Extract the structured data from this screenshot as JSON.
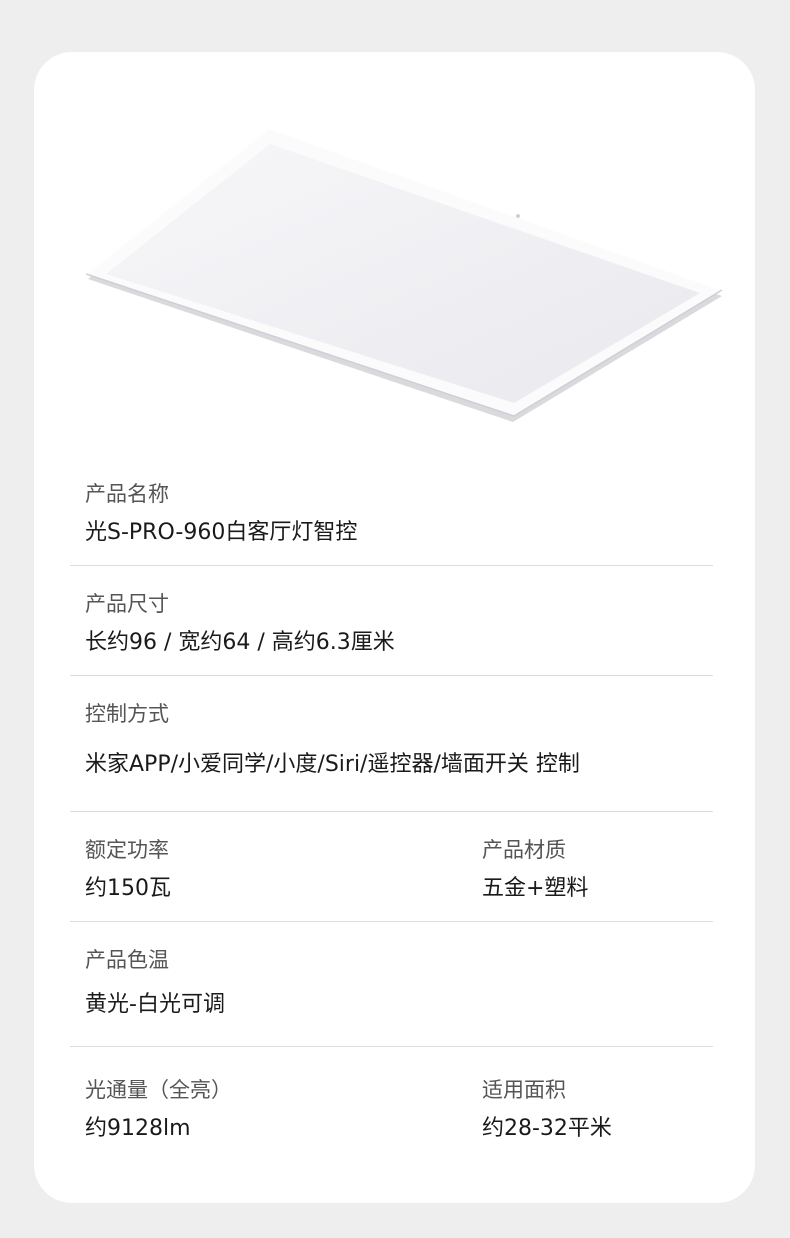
{
  "specs": {
    "name": {
      "label": "产品名称",
      "value": "光S-PRO-960白客厅灯智控"
    },
    "size": {
      "label": "产品尺寸",
      "value": "长约96 / 宽约64 / 高约6.3厘米"
    },
    "control": {
      "label": "控制方式",
      "value": "米家APP/小爱同学/小度/Siri/遥控器/墙面开关 控制"
    },
    "power": {
      "label": "额定功率",
      "value": "约150瓦"
    },
    "material": {
      "label": "产品材质",
      "value": "五金+塑料"
    },
    "color_temp": {
      "label": "产品色温",
      "value": "黄光-白光可调"
    },
    "lumen": {
      "label": "光通量（全亮）",
      "value": "约9128lm"
    },
    "area": {
      "label": "适用面积",
      "value": "约28-32平米"
    }
  }
}
